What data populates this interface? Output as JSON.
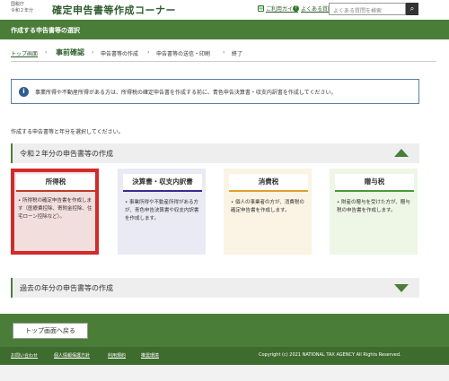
{
  "header": {
    "agency_line1": "国税庁",
    "agency_line2": "令和２年分",
    "title": "確定申告書等作成コーナー",
    "guide_link": "ご利用ガイド",
    "faq_link": "よくある質問",
    "search_placeholder": "よくある質問を検索",
    "search_icon": "search-icon"
  },
  "green_bar": {
    "title": "作成する申告書等の選択"
  },
  "steps": {
    "top": "トップ画面",
    "current": "事前確認",
    "step2": "申告書等の作成",
    "step3": "申告書等の送信・印刷",
    "step4": "終了",
    "separator": "›"
  },
  "info": {
    "icon": "i",
    "text": "事業所得や不動産所得がある方は、所得税の確定申告書を作成する前に、青色申告決算書・収支内訳書を作成してください。"
  },
  "instruction": "作成する申告書等と年分を選択してください。",
  "section_current": {
    "title": "令和２年分の申告書等の作成"
  },
  "cards": [
    {
      "title": "所得税",
      "desc": "所得税の確定申告書を作成します（医療費控除、寄附金控除、住宅ローン控除など）。"
    },
    {
      "title": "決算書・収支内訳書",
      "desc": "事業所得や不動産所得がある方が、青色申告決算書や収支内訳書を作成します。"
    },
    {
      "title": "消費税",
      "desc": "個人の事業者の方が、消費税の確定申告書を作成します。"
    },
    {
      "title": "贈与税",
      "desc": "財産の贈与を受けた方が、贈与税の申告書を作成します。"
    }
  ],
  "section_past": {
    "title": "過去の年分の申告書等の作成"
  },
  "footer": {
    "back_button": "トップ画面へ戻る",
    "links": [
      "お問い合わせ",
      "個人情報保護方針",
      "利用規約",
      "推奨環境"
    ],
    "copyright": "Copyright (c) 2021 NATIONAL TAX AGENCY All Rights Reserved."
  },
  "colors": {
    "brand_green": "#4a7d38",
    "selected_border": "#d12b2b",
    "info_border": "#5b7fa6"
  }
}
